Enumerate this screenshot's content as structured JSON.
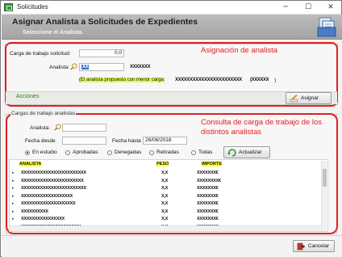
{
  "window": {
    "title": "Solicitudes",
    "minimize": "─",
    "maximize": "☐",
    "close": "✕"
  },
  "header": {
    "title": "Asignar Analista a Solicitudes de Expedientes",
    "subtitle": "Seleccione el Analista."
  },
  "assign_section": {
    "heading": "Asignación de analista",
    "carga_label": "Carga de trabajo solicitud:",
    "carga_value": "0,0",
    "analista_label": "Analista:",
    "analista_code": "XX",
    "analista_name": "XXXXXXX",
    "suggestion": "(El analista propuesto con menor carga:",
    "suggestion_name": "XXXXXXXXXXXXXXXXXXXXXXX",
    "suggestion_extra": "(XXXXXX",
    "suggestion_end": ")",
    "acciones_label": "Acciones",
    "assign_button": "Asignar"
  },
  "workload_section": {
    "group_title": "Cargas de trabajo analistas",
    "heading_line1": "Consulta de carga de trabajo de los",
    "heading_line2": "distintos analistas",
    "analista_label": "Analista:",
    "fecha_desde_label": "Fecha desde",
    "fecha_desde_value": "",
    "fecha_hasta_label": "Fecha hasta",
    "fecha_hasta_value": "26/06/2018",
    "radios": [
      {
        "label": "En estudio",
        "selected": true
      },
      {
        "label": "Aprobadas",
        "selected": false
      },
      {
        "label": "Denegadas",
        "selected": false
      },
      {
        "label": "Retiradas",
        "selected": false
      },
      {
        "label": "Todas",
        "selected": false
      }
    ],
    "update_button": "Actualizar"
  },
  "grid": {
    "columns": [
      "ANALISTA",
      "PESO",
      "IMPORTE"
    ],
    "rows": [
      {
        "analista": "XXXXXXXXXXXXXXXXXXXXXXXX",
        "peso": "X,X",
        "importe": "XXXXXXX€"
      },
      {
        "analista": "XXXXXXXXXXXXXXXXXXXXXXX",
        "peso": "X,X",
        "importe": "XXXXXXXX€"
      },
      {
        "analista": "XXXXXXXXXXXXXXXXXXXXXXXX",
        "peso": "X,X",
        "importe": "XXXXXXX€"
      },
      {
        "analista": "XXXXXXXXXXXXXXXXXXX",
        "peso": "X,X",
        "importe": "XXXXXXX€"
      },
      {
        "analista": "XXXXXXXXXXXXXXXXXXXX",
        "peso": "X,X",
        "importe": "XXXXXXX€"
      },
      {
        "analista": "XXXXXXXXXX",
        "peso": "X,X",
        "importe": "XXXXXXX€"
      },
      {
        "analista": "XXXXXXXXXXXXXXXX",
        "peso": "X,X",
        "importe": "XXXXXXX€"
      },
      {
        "analista": "XXXXXXXXXXXXXXXXXXXXXX",
        "peso": "X,X",
        "importe": "XXXXXXX€"
      }
    ]
  },
  "footer": {
    "cancel_button": "Cancelar"
  },
  "colors": {
    "annotation_red": "#e02020",
    "highlight_yellow": "#ffff33",
    "acciones_green": "#2e7d2e"
  }
}
